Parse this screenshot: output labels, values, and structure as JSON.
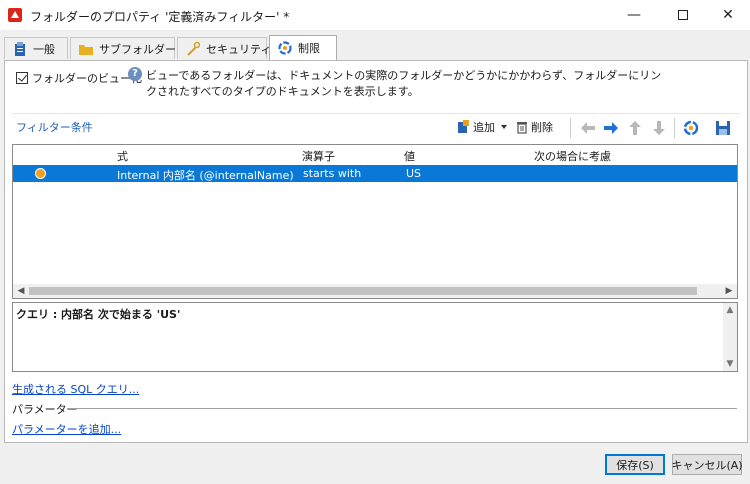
{
  "window": {
    "title": "フォルダーのプロパティ '定義済みフィルター' *",
    "minimize": "—",
    "close": "✕"
  },
  "tabs": [
    {
      "label": "一般",
      "icon": "clipboard-icon"
    },
    {
      "label": "サブフォルダー",
      "icon": "folder-icon"
    },
    {
      "label": "セキュリティ",
      "icon": "key-icon"
    },
    {
      "label": "制限",
      "icon": "restriction-icon",
      "active": true
    }
  ],
  "view": {
    "checkbox_label": "フォルダーのビュー化",
    "checked": true,
    "description": "ビューであるフォルダーは、ドキュメントの実際のフォルダーかどうかにかかわらず、フォルダーにリンクされたすべてのタイプのドキュメントを表示します。"
  },
  "filter": {
    "label": "フィルター条件",
    "toolbar": {
      "add": "追加",
      "delete": "削除"
    },
    "columns": [
      "式",
      "演算子",
      "値",
      "次の場合に考慮"
    ],
    "rows": [
      {
        "expression": "Internal  内部名 (@internalName)",
        "operator": "starts with",
        "value": "US",
        "condition": ""
      }
    ]
  },
  "query": {
    "text": "クエリ : 内部名 次で始まる 'US'"
  },
  "links": {
    "sql": "生成される SQL クエリ...",
    "add_param": "パラメーターを追加..."
  },
  "params": {
    "label": "パラメーター"
  },
  "buttons": {
    "save": "保存(S)",
    "cancel": "キャンセル(A)"
  },
  "colors": {
    "selection": "#0a78d7",
    "accent_link": "#0645c8",
    "arrow_blue": "#1e6fd9"
  }
}
